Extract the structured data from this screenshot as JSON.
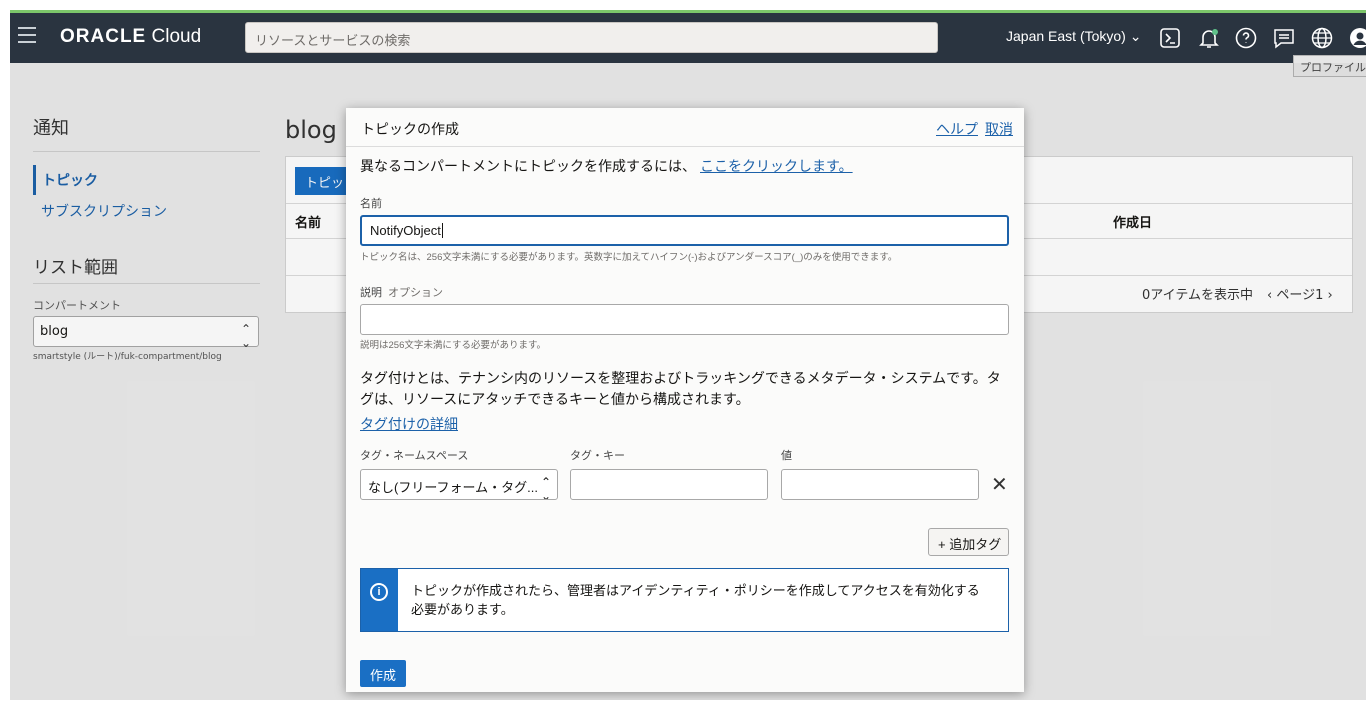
{
  "topbar": {
    "brand_bold": "ORACLE",
    "brand_light": "Cloud",
    "search_placeholder": "リソースとサービスの検索",
    "region": "Japan East (Tokyo)",
    "profile_tooltip": "プロファイル"
  },
  "sidebar": {
    "title": "通知",
    "items": [
      {
        "label": "トピック",
        "active": true
      },
      {
        "label": "サブスクリプション",
        "active": false
      }
    ],
    "scope_title": "リスト範囲",
    "compartment_label": "コンパートメント",
    "compartment_value": "blog",
    "compartment_path": "smartstyle (ルート)/fuk-compartment/blog"
  },
  "background": {
    "heading": "blog コ",
    "button": "トピッ",
    "col_name": "名前",
    "col_created": "作成日",
    "count_text": "0アイテムを表示中",
    "page_text": "ページ1"
  },
  "dialog": {
    "title": "トピックの作成",
    "help": "ヘルプ",
    "cancel": "取消",
    "intro_text": "異なるコンパートメントにトピックを作成するには、",
    "intro_link": "ここをクリックします。",
    "name_label": "名前",
    "name_value": "NotifyObject",
    "name_hint": "トピック名は、256文字未満にする必要があります。英数字に加えてハイフン(-)およびアンダースコア(_)のみを使用できます。",
    "desc_label": "説明",
    "desc_optional": "オプション",
    "desc_value": "",
    "desc_hint": "説明は256文字未満にする必要があります。",
    "tag_paragraph": "タグ付けとは、テナンシ内のリソースを整理およびトラッキングできるメタデータ・システムです。タグは、リソースにアタッチできるキーと値から構成されます。",
    "tag_link": "タグ付けの詳細",
    "tag_ns_label": "タグ・ネームスペース",
    "tag_key_label": "タグ・キー",
    "tag_value_label": "値",
    "tag_ns_value": "なし(フリーフォーム・タグ...",
    "add_tag": "+ 追加タグ",
    "info_text": "トピックが作成されたら、管理者はアイデンティティ・ポリシーを作成してアクセスを有効化する必要があります。",
    "create_button": "作成"
  },
  "colors": {
    "topbar_bg": "#2a3440",
    "link": "#1c61a9",
    "primary_button": "#1a6fc4",
    "accent_line": "#7cc66a"
  }
}
